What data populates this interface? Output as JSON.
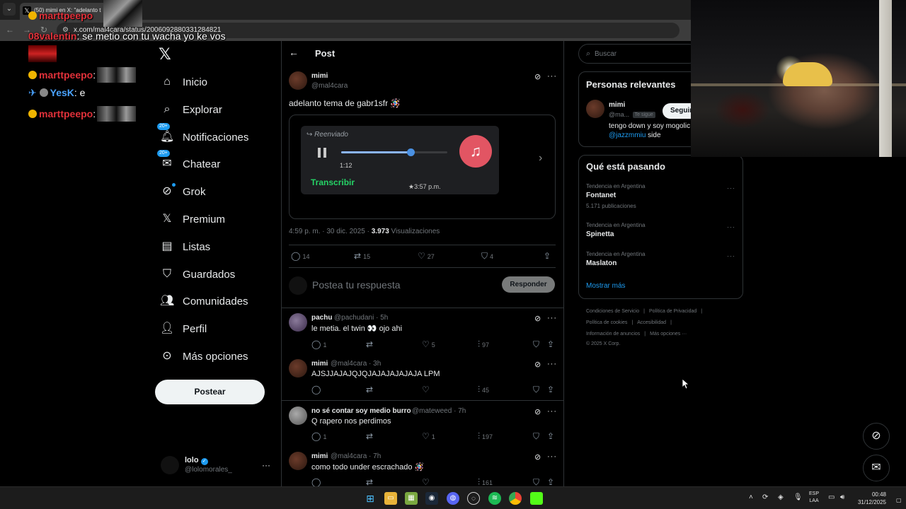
{
  "browser": {
    "tab_title": "(50) mimi en X: \"adelanto t",
    "url": "x.com/mal4cara/status/2006092880331284821"
  },
  "chat": [
    {
      "user": "marttpeepo",
      "message": ""
    },
    {
      "user": "08valentin",
      "message": ": se metio con tu wacha yo ke vos"
    },
    {
      "user": "marttpeepo",
      "message": ":"
    },
    {
      "user": "YesK",
      "message": ": e"
    },
    {
      "user": "marttpeepo",
      "message": ":"
    }
  ],
  "nav": {
    "items": [
      {
        "label": "Inicio",
        "icon": "home-icon"
      },
      {
        "label": "Explorar",
        "icon": "search-icon"
      },
      {
        "label": "Notificaciones",
        "icon": "bell-icon",
        "badge": "20+"
      },
      {
        "label": "Chatear",
        "icon": "mail-icon",
        "badge": "20+"
      },
      {
        "label": "Grok",
        "icon": "grok-icon"
      },
      {
        "label": "Premium",
        "icon": "x-icon"
      },
      {
        "label": "Listas",
        "icon": "list-icon"
      },
      {
        "label": "Guardados",
        "icon": "bookmark-icon"
      },
      {
        "label": "Comunidades",
        "icon": "people-icon"
      },
      {
        "label": "Perfil",
        "icon": "person-icon"
      },
      {
        "label": "Más opciones",
        "icon": "more-circle-icon"
      }
    ],
    "post_button": "Postear",
    "account": {
      "name": "lolo",
      "handle": "@lolomorales_"
    }
  },
  "main": {
    "title": "Post",
    "post": {
      "name": "mimi",
      "handle": "@mal4cara",
      "text": "adelanto tema de gabr1sfr 🪅",
      "media": {
        "forwarded": "Reenviado",
        "duration": "1:12",
        "progress": 0.65,
        "transcribe": "Transcribir",
        "timestamp": "★3:57 p.m."
      },
      "time": "4:59 p. m. · 30 dic. 2025 · ",
      "views": "3.973",
      "views_label": " Visualizaciones",
      "stats": {
        "replies": "14",
        "reposts": "15",
        "likes": "27",
        "bookmarks": "4"
      }
    },
    "reply_box": {
      "placeholder": "Postea tu respuesta",
      "button": "Responder"
    },
    "replies": [
      {
        "name": "pachu",
        "handle": "@pachudani · 5h",
        "text": "le metia. el twin 👀 ojo ahi",
        "replies": "1",
        "reposts": "",
        "likes": "5",
        "views": "97"
      },
      {
        "name": "mimi",
        "handle": "@mal4cara · 3h",
        "text": "AJSJJAJAJQJQJAJAJAJAJAJA LPM",
        "replies": "",
        "reposts": "",
        "likes": "",
        "views": "45"
      },
      {
        "name": "no sé contar soy medio burro",
        "handle": "@mateweed · 7h",
        "text": "Q rapero nos perdimos",
        "replies": "1",
        "reposts": "",
        "likes": "1",
        "views": "197"
      },
      {
        "name": "mimi",
        "handle": "@mal4cara · 7h",
        "text": "como todo under escrachado 🪅",
        "replies": "",
        "reposts": "",
        "likes": "",
        "views": "161"
      }
    ]
  },
  "right": {
    "search_placeholder": "Buscar",
    "relevant": {
      "title": "Personas relevantes",
      "name": "mimi",
      "handle": "@ma...",
      "follows_you": "Te sigue",
      "follow_button": "Seguir",
      "bio": "tengo down y soy mogolic",
      "bio_link": "@jazzmmiu",
      "bio_tail": " side"
    },
    "trends": {
      "title": "Qué está pasando",
      "items": [
        {
          "category": "Tendencia en Argentina",
          "name": "Fontanet",
          "count": "5.171 publicaciones"
        },
        {
          "category": "Tendencia en Argentina",
          "name": "Spinetta",
          "count": ""
        },
        {
          "category": "Tendencia en Argentina",
          "name": "Maslaton",
          "count": ""
        }
      ],
      "show_more": "Mostrar más"
    },
    "footer": {
      "line1": [
        "Condiciones de Servicio",
        "Política de Privacidad"
      ],
      "line2": [
        "Política de cookies",
        "Accesibilidad"
      ],
      "line3": [
        "Información de anuncios",
        "Más opciones ···"
      ],
      "copyright": "© 2025 X Corp."
    }
  },
  "taskbar": {
    "lang_top": "ESP",
    "lang_bottom": "LAA",
    "time": "00:48",
    "date": "31/12/2025"
  }
}
